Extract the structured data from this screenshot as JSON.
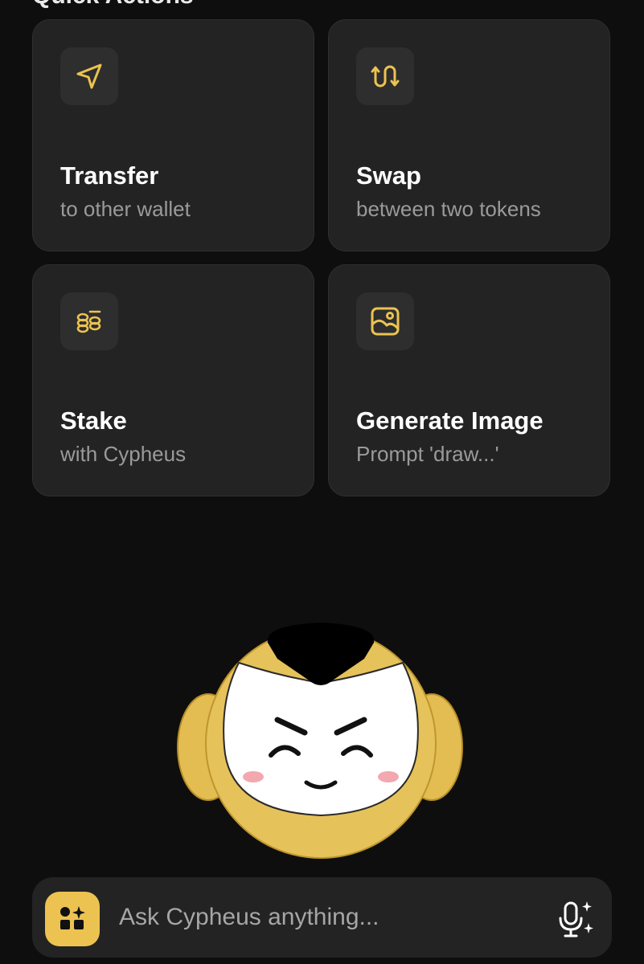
{
  "header": {
    "title": "Quick Actions"
  },
  "actions": [
    {
      "title": "Transfer",
      "subtitle": "to other wallet",
      "icon": "send-icon"
    },
    {
      "title": "Swap",
      "subtitle": "between two tokens",
      "icon": "swap-icon"
    },
    {
      "title": "Stake",
      "subtitle": "with Cypheus",
      "icon": "stake-coins-icon"
    },
    {
      "title": "Generate Image",
      "subtitle": "Prompt 'draw...'",
      "icon": "image-icon"
    }
  ],
  "assistant": {
    "name": "Cypheus",
    "mascot": "cypheus-mascot"
  },
  "ask_bar": {
    "placeholder": "Ask Cypheus anything...",
    "apps_icon": "apps-sparkle-icon",
    "mic_icon": "mic-sparkle-icon"
  },
  "colors": {
    "background": "#0e0e0e",
    "card": "#232323",
    "accent": "#ecc351",
    "subtitle": "#9a9a9a"
  }
}
